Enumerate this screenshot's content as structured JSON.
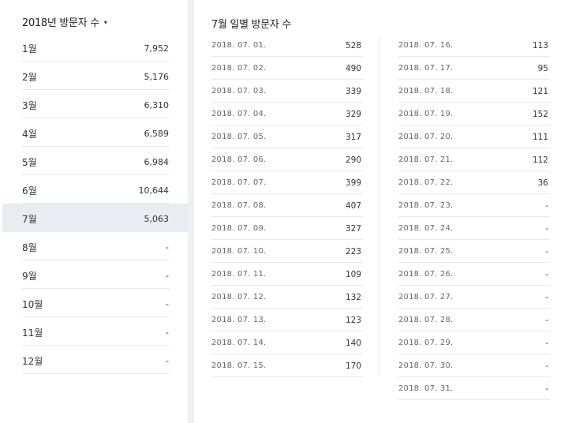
{
  "monthly": {
    "title": "2018년 방문자 수",
    "caret": "▾",
    "selected_index": 6,
    "months": [
      {
        "label": "1월",
        "value": "7,952"
      },
      {
        "label": "2월",
        "value": "5,176"
      },
      {
        "label": "3월",
        "value": "6,310"
      },
      {
        "label": "4월",
        "value": "6,589"
      },
      {
        "label": "5월",
        "value": "6,984"
      },
      {
        "label": "6월",
        "value": "10,644"
      },
      {
        "label": "7월",
        "value": "5,063"
      },
      {
        "label": "8월",
        "value": "-"
      },
      {
        "label": "9월",
        "value": "-"
      },
      {
        "label": "10월",
        "value": "-"
      },
      {
        "label": "11월",
        "value": "-"
      },
      {
        "label": "12월",
        "value": "-"
      }
    ]
  },
  "daily": {
    "title": "7월 일별 방문자 수",
    "days": [
      {
        "date": "2018. 07. 01.",
        "value": "528"
      },
      {
        "date": "2018. 07. 02.",
        "value": "490"
      },
      {
        "date": "2018. 07. 03.",
        "value": "339"
      },
      {
        "date": "2018. 07. 04.",
        "value": "329"
      },
      {
        "date": "2018. 07. 05.",
        "value": "317"
      },
      {
        "date": "2018. 07. 06.",
        "value": "290"
      },
      {
        "date": "2018. 07. 07.",
        "value": "399"
      },
      {
        "date": "2018. 07. 08.",
        "value": "407"
      },
      {
        "date": "2018. 07. 09.",
        "value": "327"
      },
      {
        "date": "2018. 07. 10.",
        "value": "223"
      },
      {
        "date": "2018. 07. 11.",
        "value": "109"
      },
      {
        "date": "2018. 07. 12.",
        "value": "132"
      },
      {
        "date": "2018. 07. 13.",
        "value": "123"
      },
      {
        "date": "2018. 07. 14.",
        "value": "140"
      },
      {
        "date": "2018. 07. 15.",
        "value": "170"
      },
      {
        "date": "2018. 07. 16.",
        "value": "113"
      },
      {
        "date": "2018. 07. 17.",
        "value": "95"
      },
      {
        "date": "2018. 07. 18.",
        "value": "121"
      },
      {
        "date": "2018. 07. 19.",
        "value": "152"
      },
      {
        "date": "2018. 07. 20.",
        "value": "111"
      },
      {
        "date": "2018. 07. 21.",
        "value": "112"
      },
      {
        "date": "2018. 07. 22.",
        "value": "36"
      },
      {
        "date": "2018. 07. 23.",
        "value": "-"
      },
      {
        "date": "2018. 07. 24.",
        "value": "-"
      },
      {
        "date": "2018. 07. 25.",
        "value": "-"
      },
      {
        "date": "2018. 07. 26.",
        "value": "-"
      },
      {
        "date": "2018. 07. 27.",
        "value": "-"
      },
      {
        "date": "2018. 07. 28.",
        "value": "-"
      },
      {
        "date": "2018. 07. 29.",
        "value": "-"
      },
      {
        "date": "2018. 07. 30.",
        "value": "-"
      },
      {
        "date": "2018. 07. 31.",
        "value": "-"
      }
    ]
  }
}
